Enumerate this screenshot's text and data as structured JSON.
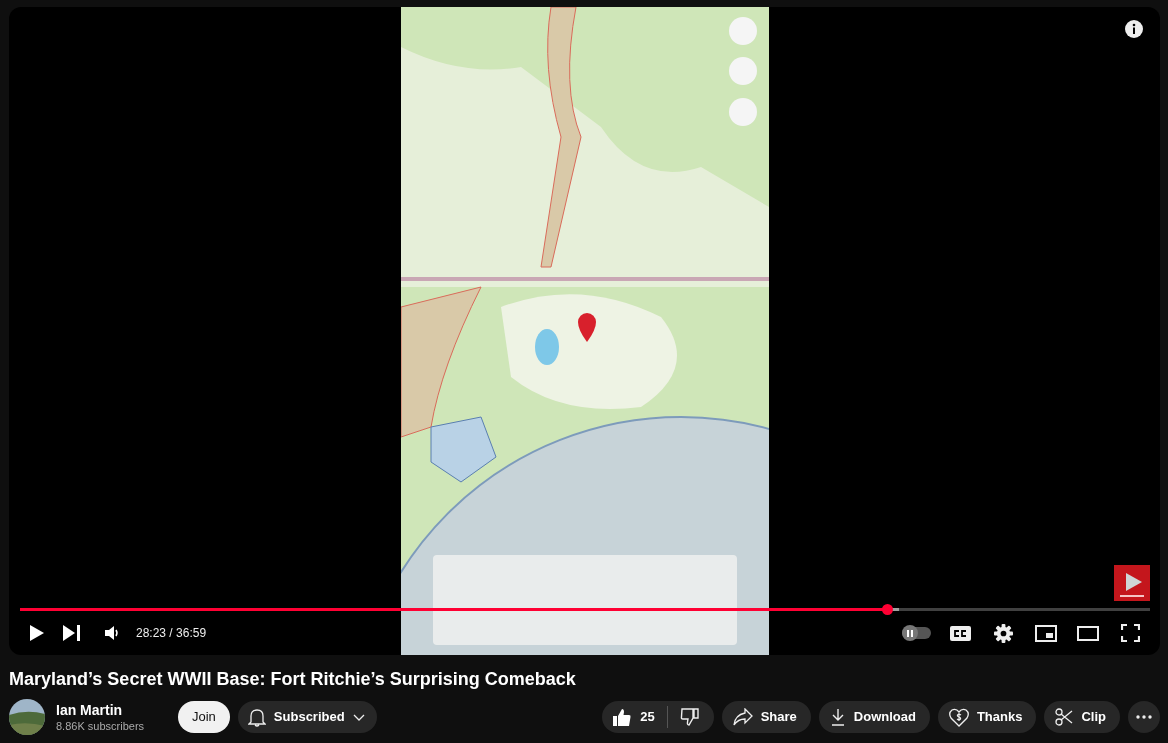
{
  "player": {
    "progress": {
      "level": 0.767
    },
    "time": "28:23 / 36:59",
    "autoplay": {
      "on": false
    }
  },
  "title": "Maryland’s Secret WWII Base: Fort Ritchie’s Surprising Comeback",
  "channel": {
    "name": "Ian Martin",
    "subscribers": "8.86K subscribers"
  },
  "join": "Join",
  "subscribe": {
    "label": "Subscribed"
  },
  "likes": "25",
  "actions": [
    {
      "kind": "share",
      "label": "Share"
    },
    {
      "kind": "download",
      "label": "Download"
    },
    {
      "kind": "thanks",
      "label": "Thanks"
    },
    {
      "kind": "clip",
      "label": "Clip"
    }
  ]
}
